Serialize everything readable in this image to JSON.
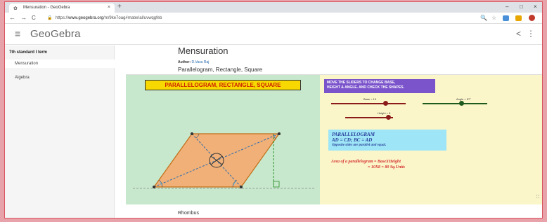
{
  "browser": {
    "tab_title": "Mensuration - GeoGebra",
    "tab_icon": "geogebra-favicon",
    "close": "×",
    "new_tab": "+",
    "url_prefix": "https://",
    "url_host": "www.geogebra.org",
    "url_path": "/m/9ke7oag#material/uvwqgfeb",
    "min": "–",
    "max": "□",
    "x": "×"
  },
  "nav": {
    "back": "←",
    "forward": "→",
    "reload": "C",
    "lock": "🔒",
    "zoom": "🔍",
    "star": "☆"
  },
  "header": {
    "brand": "GeoGebra",
    "menu": "≡",
    "share": "<",
    "more": "⋮"
  },
  "sidebar": {
    "title": "7th standard I term",
    "items": [
      {
        "label": "Mensuration"
      },
      {
        "label": "Algebra"
      }
    ]
  },
  "content": {
    "title": "Mensuration",
    "author_label": "Author:",
    "author_name": "D.Vasu Raj",
    "subtitle": "Parallelogram, Rectangle, Square",
    "next_section": "Rhombus"
  },
  "applet": {
    "banner": "PARALLELOGRAM, RECTANGLE, SQUARE",
    "instruction_l1": "MOVE THE SLIDERS TO CHANGE BASE,",
    "instruction_l2": "HEIGHT & ANGLE. AND CHECK THE SHAPES.",
    "slider_base": "Base = 10",
    "slider_angle": "Angle = 57°",
    "slider_height": "Height = 8",
    "info_l1": "PARALLELOGRAM",
    "info_l2": "AD = CD; BC = AD",
    "info_l3": "Opposite sides are parallel and equal.",
    "area_l1": "Area of a parallelogram  = BaseXHeight",
    "area_l2": "= 10X8 = 80 Sq.Units",
    "fullscreen": "⛶",
    "colors": {
      "left_bg": "#c7e8cc",
      "right_bg": "#fbf6c9",
      "shape": "#f0b078",
      "banner": "#f7d800",
      "instr": "#7b54cc",
      "info": "#9ee6f7"
    }
  }
}
